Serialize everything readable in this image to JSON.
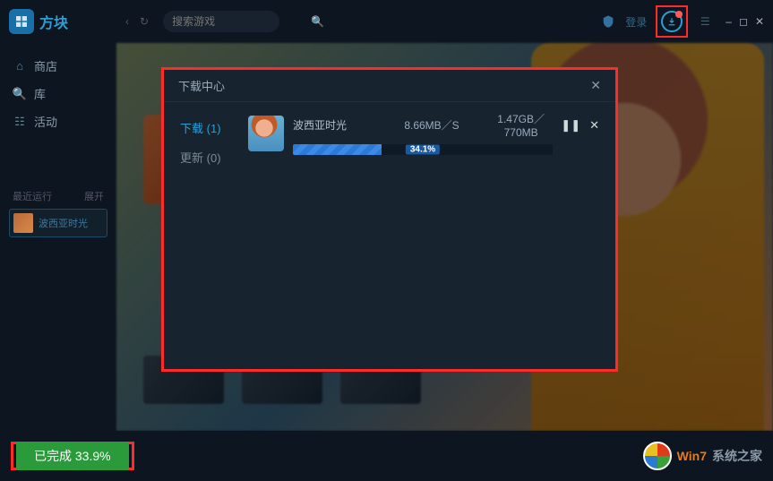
{
  "app": {
    "name": "方块"
  },
  "topbar": {
    "search_placeholder": "搜索游戏",
    "login_label": "登录"
  },
  "sidebar": {
    "items": [
      {
        "label": "商店"
      },
      {
        "label": "库"
      },
      {
        "label": "活动"
      }
    ],
    "running_header": "最近运行",
    "running_header_right": "展开",
    "running_item": "波西亚时光"
  },
  "modal": {
    "title": "下载中心",
    "tabs": {
      "download": {
        "label": "下载",
        "count": 1
      },
      "update": {
        "label": "更新",
        "count": 0
      }
    },
    "item": {
      "name": "波西亚时光",
      "speed": "8.66MB／S",
      "size": "1.47GB／770MB",
      "progress_pct": 34.1,
      "progress_label": "34.1%"
    }
  },
  "bottom": {
    "done_prefix": "已完成",
    "done_pct": "33.9%",
    "watermark_a": "Win7",
    "watermark_b": "系统之家"
  }
}
